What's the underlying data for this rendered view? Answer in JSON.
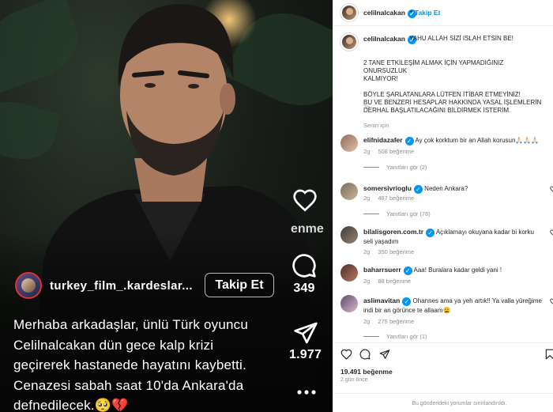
{
  "media": {
    "overlay_username": "turkey_film_.kardeslar...",
    "overlay_follow": "Takip Et",
    "side_text": "enme",
    "comments_count": "349",
    "shares_count": "1.977",
    "caption": [
      "Merhaba arkadaşlar, ünlü Türk oyuncu",
      "Celilnalcakan dün gece kalp krizi",
      "geçirerek hastanede hayatını kaybetti.",
      "Cenazesi sabah saat 10'da Ankara'da",
      "defnedilecek.🥺💔"
    ]
  },
  "header": {
    "username": "celilnalcakan",
    "separator": "•",
    "follow": "Takip Et"
  },
  "post": {
    "username": "celilnalcakan",
    "first_line": "YAHU ALLAH SİZİ ISLAH ETSİN BE!",
    "lines": [
      "",
      "2 TANE ETKİLEŞİM ALMAK İÇİN YAPMADIĞINIZ ONURSUZLUK",
      "KALMIYOR!",
      "",
      "BÖYLE ŞARLATANLARA LÜTFEN İTİBAR ETMEYİNİZ!",
      "BU VE BENZERİ HESAPLAR HAKKINDA YASAL İŞLEMLERİN",
      "DERHAL BAŞLATILACAĞINI BİLDİRMEK İSTERİM."
    ],
    "time": "2g",
    "translate": "Senin için"
  },
  "comments": [
    {
      "user": "elifnidazafer",
      "text": "Ay çok korktum bir an Allah korusun🙏🏻🙏🏻🙏🏻",
      "time": "2g",
      "likes": "508 beğenme",
      "replies": "Yanıtları gör (2)",
      "colors": [
        "#8d6b5a",
        "#e0c2a8"
      ]
    },
    {
      "user": "somersivrioglu",
      "text": "Neden Ankara?",
      "time": "2g",
      "likes": "487 beğenme",
      "replies": "Yanıtları gör (78)",
      "colors": [
        "#7a6a5a",
        "#c9b7a0"
      ]
    },
    {
      "user": "bilalisgoren.com.tr",
      "text": "Açıklamayı okuyana kadar bi korku seli yaşadım",
      "time": "2g",
      "likes": "350 beğenme",
      "replies": "",
      "colors": [
        "#3b3b3b",
        "#9a8574"
      ]
    },
    {
      "user": "baharrsuerr",
      "text": "Aaa! Buralara kadar geldi yani !",
      "time": "2g",
      "likes": "88 beğenme",
      "replies": "",
      "colors": [
        "#4a2e2a",
        "#b57b64"
      ]
    },
    {
      "user": "aslimavitan",
      "text": "Ohannes ama ya yeh artık!! Ya valla yüreğime indi bir an görünce te allaam😩",
      "time": "2g",
      "likes": "275 beğenme",
      "replies": "Yanıtları gör (1)",
      "colors": [
        "#5a4a6a",
        "#d9b9c9"
      ]
    }
  ],
  "footer": {
    "likes": "19.491 beğenme",
    "ago": "2 gün önce",
    "restricted": "Bu gönderideki yorumlar sınırlandırıldı."
  }
}
